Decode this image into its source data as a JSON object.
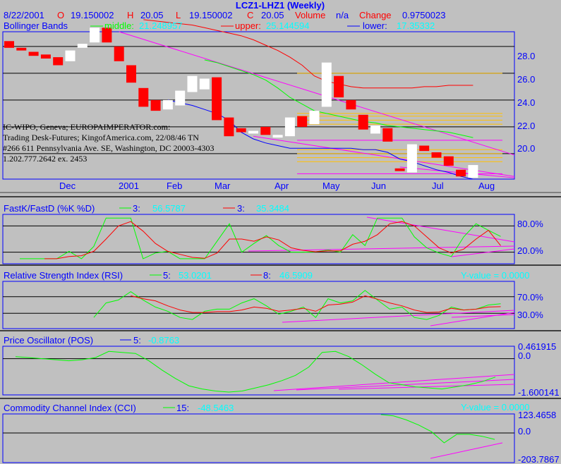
{
  "colors": {
    "bg": "#c0c0c0",
    "frame": "#0000ff",
    "grid": "#000000",
    "up_candle": "#ffffff",
    "down_candle": "#ff0000",
    "label_blue": "#0000ff",
    "label_red": "#ff0000",
    "label_cyan": "#00ffff",
    "value_cyan": "#00ffff",
    "green_line": "#00ff00",
    "red_line": "#ff0000",
    "blue_line": "#0000ff",
    "magenta_line": "#ff00ff",
    "gold_line": "#ffc000"
  },
  "header": {
    "title": "LCZ1-LHZ1 (Weekly)",
    "date": "8/22/2001",
    "o_label": "O",
    "o_value": "19.150002",
    "h_label": "H",
    "h_value": "20.05",
    "l_label": "L",
    "l_value": "19.150002",
    "c_label": "C",
    "c_value": "20.05",
    "volume_label": "Volume",
    "volume_value": "n/a",
    "change_label": "Change",
    "change_value": "0.9750023"
  },
  "bollinger": {
    "label": "Bollinger Bands",
    "middle_label": "middle:",
    "middle_value": "21.248957",
    "upper_label": "upper:",
    "upper_value": "25.144594",
    "lower_label": "lower:",
    "lower_value": "17.35332"
  },
  "watermark": [
    "IC-WIPO, Geneva; EUROPAIMPERATOR.com:",
    "Trading Desk-Futures; KingofAmerica.com, 22/08/46 TN",
    "#266 611 Pennsylvania Ave. SE, Washington, DC 20003-4303",
    "1.202.777.2642 ex. 2453"
  ],
  "x_labels": [
    "Dec",
    "2001",
    "Feb",
    "Mar",
    "Apr",
    "May",
    "Jun",
    "Jul",
    "Aug"
  ],
  "stoch": {
    "label": "FastK/FastD (%K %D)",
    "k_period": "3:",
    "k_value": "56.5787",
    "d_period": "3:",
    "d_value": "35.3484",
    "levels": [
      "80.0%",
      "20.0%"
    ]
  },
  "rsi": {
    "label": "Relative Strength Index (RSI)",
    "p1": "5:",
    "v1": "53.0201",
    "p2": "8:",
    "v2": "46.5909",
    "yvalue": "Y-value = 0.0000",
    "levels": [
      "70.0%",
      "30.0%"
    ]
  },
  "pos": {
    "label": "Price Oscillator (POS)",
    "p1": "5:",
    "v1": "-0.8763",
    "ticks": [
      "0.461915",
      "0.0",
      "-1.600141"
    ]
  },
  "cci": {
    "label": "Commodity Channel Index (CCI)",
    "p1": "15:",
    "v1": "-48.5463",
    "yvalue": "Y-value = 0.0000",
    "ticks": [
      "123.4658",
      "0.0",
      "-203.7867"
    ]
  },
  "chart_data": [
    {
      "type": "candlestick",
      "title": "LCZ1-LHZ1 (Weekly)",
      "y_ticks": [
        "28.0",
        "26.0",
        "24.0",
        "22.0",
        "20.0"
      ],
      "ylim": [
        18.1,
        29.1
      ],
      "candles": [
        {
          "o": 28.4,
          "c": 27.9
        },
        {
          "o": 27.9,
          "c": 27.7
        },
        {
          "o": 27.6,
          "c": 27.3
        },
        {
          "o": 27.4,
          "c": 27.1
        },
        {
          "o": 27.2,
          "c": 26.6
        },
        {
          "o": 26.9,
          "c": 27.7
        },
        {
          "o": 27.9,
          "c": 28.2
        },
        {
          "o": 28.3,
          "c": 29.4
        },
        {
          "o": 29.4,
          "c": 28.3
        },
        {
          "o": 28.0,
          "c": 26.9
        },
        {
          "o": 26.6,
          "c": 25.3
        },
        {
          "o": 24.9,
          "c": 23.5
        },
        {
          "o": 24.0,
          "c": 23.2
        },
        {
          "o": 23.3,
          "c": 24.0
        },
        {
          "o": 23.6,
          "c": 24.7
        },
        {
          "o": 24.6,
          "c": 25.8
        },
        {
          "o": 24.8,
          "c": 25.6
        },
        {
          "o": 25.7,
          "c": 22.5
        },
        {
          "o": 22.7,
          "c": 21.3
        },
        {
          "o": 21.9,
          "c": 21.6
        },
        {
          "o": 21.5,
          "c": 21.7
        },
        {
          "o": 22.0,
          "c": 21.4
        },
        {
          "o": 21.2,
          "c": 21.4
        },
        {
          "o": 21.3,
          "c": 22.7
        },
        {
          "o": 22.8,
          "c": 22.0
        },
        {
          "o": 22.2,
          "c": 23.2
        },
        {
          "o": 23.5,
          "c": 26.8
        },
        {
          "o": 25.8,
          "c": 24.2
        },
        {
          "o": 24.0,
          "c": 23.3
        },
        {
          "o": 22.9,
          "c": 21.8
        },
        {
          "o": 21.5,
          "c": 22.1
        },
        {
          "o": 21.9,
          "c": 20.9
        },
        {
          "o": 18.9,
          "c": 18.7
        },
        {
          "o": 18.6,
          "c": 20.7
        },
        {
          "o": 20.6,
          "c": 20.2
        },
        {
          "o": 20.1,
          "c": 19.7
        },
        {
          "o": 19.8,
          "c": 19.1
        },
        {
          "o": 18.8,
          "c": 18.3
        },
        {
          "o": 18.2,
          "c": 19.15
        }
      ],
      "bands": {
        "upper": [
          null,
          null,
          null,
          null,
          null,
          null,
          null,
          null,
          null,
          null,
          null,
          30.0,
          29.9,
          29.8,
          29.7,
          29.6,
          29.4,
          29.2,
          29.0,
          28.8,
          28.5,
          28.1,
          27.7,
          27.2,
          26.6,
          25.8,
          25.4,
          25.2,
          25.0,
          24.9,
          24.9,
          24.9,
          24.9,
          24.9,
          25.0,
          25.0,
          25.1,
          25.1,
          25.1
        ],
        "middle": [
          null,
          null,
          null,
          null,
          null,
          null,
          null,
          null,
          null,
          null,
          null,
          null,
          null,
          null,
          null,
          null,
          27.0,
          26.8,
          26.5,
          26.2,
          25.9,
          25.5,
          24.9,
          24.2,
          23.7,
          23.2,
          23.0,
          22.8,
          22.6,
          22.4,
          22.3,
          22.1,
          22.0,
          21.9,
          21.8,
          21.7,
          21.6,
          21.4,
          21.2
        ],
        "lower": [
          null,
          null,
          null,
          null,
          null,
          null,
          null,
          null,
          null,
          null,
          null,
          null,
          null,
          24.0,
          23.8,
          23.6,
          23.3,
          23.0,
          22.5,
          21.6,
          21.1,
          20.8,
          20.6,
          20.4,
          20.4,
          20.4,
          20.4,
          20.4,
          20.4,
          20.3,
          20.3,
          20.1,
          19.6,
          19.4,
          19.1,
          18.8,
          18.6,
          18.3,
          18.1
        ]
      },
      "gold_levels": [
        26.0,
        23.0,
        22.8,
        22.5,
        22.2,
        20.3,
        20.0,
        19.7,
        19.4
      ]
    },
    {
      "type": "line",
      "name": "FastK/FastD",
      "ylim": [
        0,
        100
      ],
      "k": [
        5,
        5,
        5,
        5,
        22,
        5,
        33,
        98,
        98,
        98,
        5,
        18,
        22,
        5,
        5,
        5,
        45,
        85,
        20,
        40,
        58,
        35,
        20,
        20,
        21,
        25,
        20,
        60,
        35,
        98,
        98,
        98,
        55,
        30,
        18,
        10,
        55,
        85,
        70,
        56
      ],
      "d": [
        null,
        null,
        5,
        5,
        10,
        12,
        22,
        50,
        80,
        90,
        68,
        40,
        22,
        15,
        8,
        6,
        18,
        50,
        50,
        45,
        55,
        48,
        30,
        24,
        21,
        23,
        23,
        38,
        45,
        60,
        85,
        90,
        80,
        55,
        30,
        18,
        27,
        50,
        70,
        35
      ]
    },
    {
      "type": "line",
      "name": "RSI",
      "ylim": [
        0,
        100
      ],
      "rsi5": [
        null,
        null,
        null,
        null,
        null,
        null,
        20,
        55,
        62,
        82,
        62,
        45,
        35,
        20,
        15,
        35,
        40,
        40,
        55,
        65,
        48,
        28,
        35,
        45,
        20,
        65,
        55,
        60,
        85,
        62,
        40,
        45,
        20,
        15,
        25,
        45,
        38,
        40,
        50,
        53
      ],
      "rsi8": [
        null,
        null,
        null,
        null,
        null,
        null,
        null,
        null,
        null,
        72,
        65,
        60,
        48,
        38,
        32,
        32,
        34,
        34,
        38,
        45,
        42,
        35,
        38,
        42,
        35,
        50,
        52,
        57,
        72,
        64,
        55,
        48,
        38,
        32,
        33,
        42,
        38,
        40,
        45,
        46
      ]
    },
    {
      "type": "line",
      "name": "POS",
      "ylim": [
        -1.6,
        0.46
      ],
      "pos5": [
        0.1,
        0.05,
        0.0,
        -0.05,
        -0.1,
        -0.05,
        0.05,
        0.35,
        0.3,
        0.25,
        -0.1,
        -0.55,
        -0.95,
        -1.3,
        -1.45,
        -1.55,
        -1.6,
        -1.55,
        -1.4,
        -1.25,
        -1.05,
        -0.8,
        -0.4,
        0.3,
        0.35,
        0.1,
        -0.3,
        -0.75,
        -1.15,
        -1.25,
        -1.35,
        -1.4,
        -1.45,
        -1.35,
        -1.25,
        -1.1,
        -0.88
      ]
    },
    {
      "type": "line",
      "name": "CCI",
      "ylim": [
        -203.7867,
        123.4658
      ],
      "cci15": [
        null,
        null,
        null,
        null,
        null,
        null,
        null,
        null,
        null,
        null,
        null,
        null,
        null,
        null,
        null,
        null,
        null,
        null,
        null,
        null,
        null,
        null,
        null,
        null,
        null,
        null,
        null,
        null,
        null,
        140,
        130,
        100,
        60,
        10,
        -75,
        -10,
        -10,
        -25,
        -48.5
      ]
    }
  ]
}
